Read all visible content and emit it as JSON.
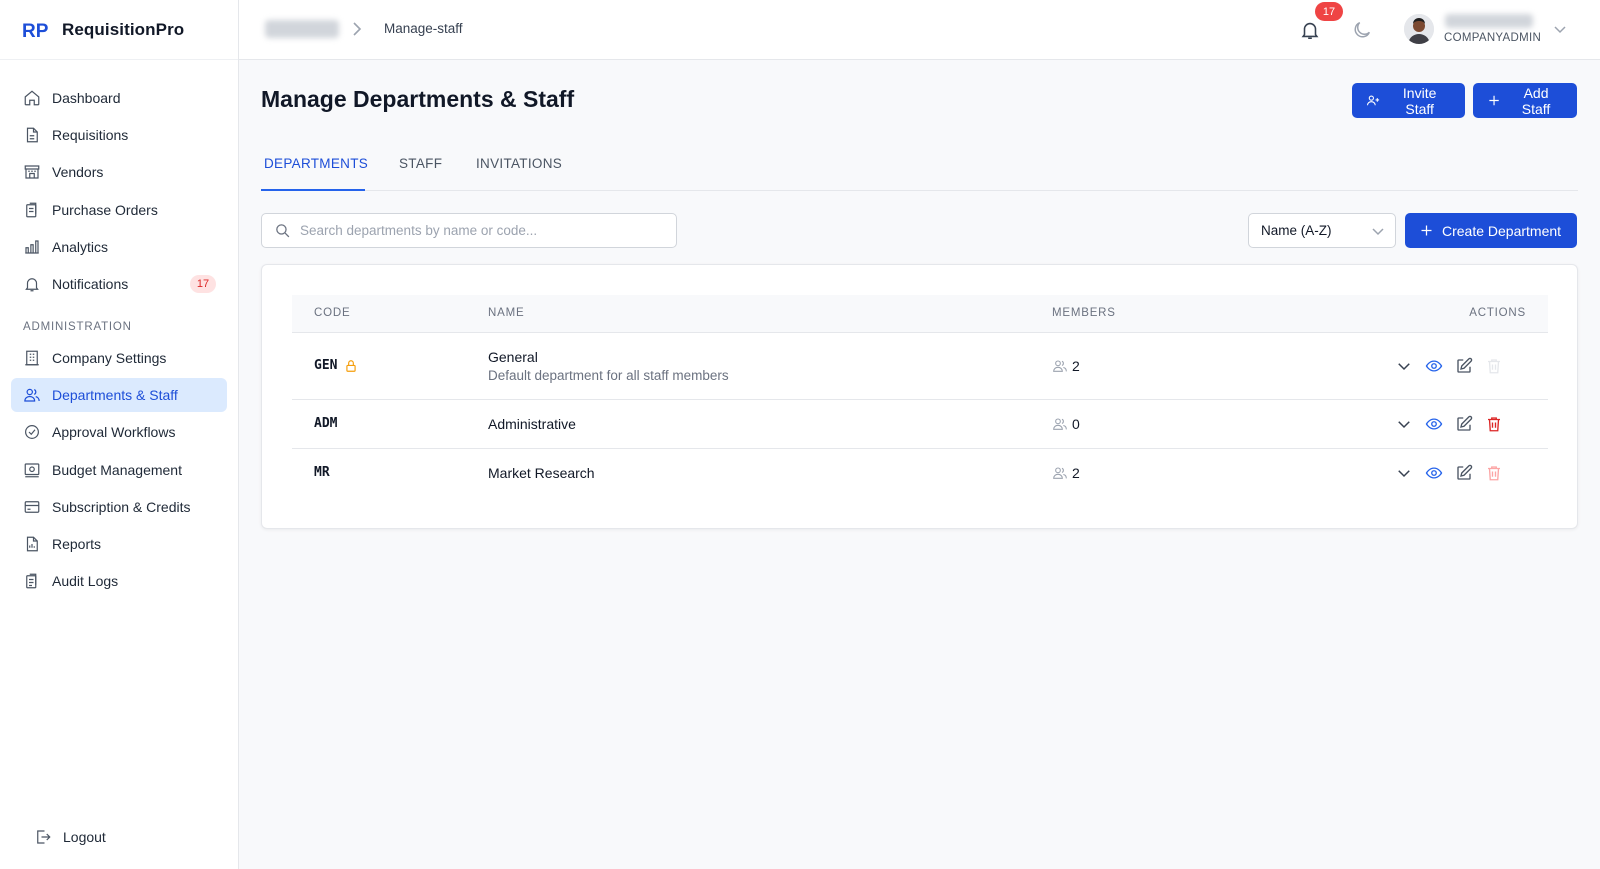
{
  "app": {
    "name": "RequisitionPro"
  },
  "sidebar": {
    "items": [
      {
        "label": "Dashboard"
      },
      {
        "label": "Requisitions"
      },
      {
        "label": "Vendors"
      },
      {
        "label": "Purchase Orders"
      },
      {
        "label": "Analytics"
      },
      {
        "label": "Notifications",
        "badge": "17"
      }
    ],
    "admin_section_label": "ADMINISTRATION",
    "admin_items": [
      {
        "label": "Company Settings"
      },
      {
        "label": "Departments & Staff",
        "active": true
      },
      {
        "label": "Approval Workflows"
      },
      {
        "label": "Budget Management"
      },
      {
        "label": "Subscription & Credits"
      },
      {
        "label": "Reports"
      },
      {
        "label": "Audit Logs"
      }
    ],
    "logout_label": "Logout"
  },
  "topbar": {
    "breadcrumb_current": "Manage-staff",
    "notification_count": "17",
    "user_role": "COMPANYADMIN"
  },
  "page": {
    "title": "Manage Departments & Staff",
    "invite_label": "Invite Staff",
    "add_label": "Add Staff",
    "tabs": [
      {
        "label": "DEPARTMENTS",
        "active": true
      },
      {
        "label": "STAFF"
      },
      {
        "label": "INVITATIONS"
      }
    ],
    "search_placeholder": "Search departments by name or code...",
    "sort_value": "Name (A-Z)",
    "create_label": "Create Department"
  },
  "table": {
    "headers": {
      "code": "CODE",
      "name": "NAME",
      "members": "MEMBERS",
      "actions": "ACTIONS"
    },
    "rows": [
      {
        "code": "GEN",
        "locked": true,
        "name": "General",
        "description": "Default department for all staff members",
        "members": "2"
      },
      {
        "code": "ADM",
        "locked": false,
        "name": "Administrative",
        "description": "",
        "members": "0"
      },
      {
        "code": "MR",
        "locked": false,
        "name": "Market Research",
        "description": "",
        "members": "2"
      }
    ]
  },
  "colors": {
    "accent": "#1d4ed8",
    "active_bg": "#dbeafe",
    "danger": "#dc2626",
    "lock": "#f59e0b"
  },
  "icons": [
    "home-icon",
    "document-icon",
    "store-icon",
    "clipboard-icon",
    "bar-chart-icon",
    "bell-icon",
    "building-icon",
    "users-icon",
    "workflow-icon",
    "budget-icon",
    "credit-card-icon",
    "report-icon",
    "audit-icon",
    "logout-icon",
    "moon-icon",
    "search-icon",
    "lock-icon",
    "eye-icon",
    "edit-icon",
    "trash-icon",
    "chevron-down-icon",
    "plus-icon",
    "user-plus-icon"
  ]
}
